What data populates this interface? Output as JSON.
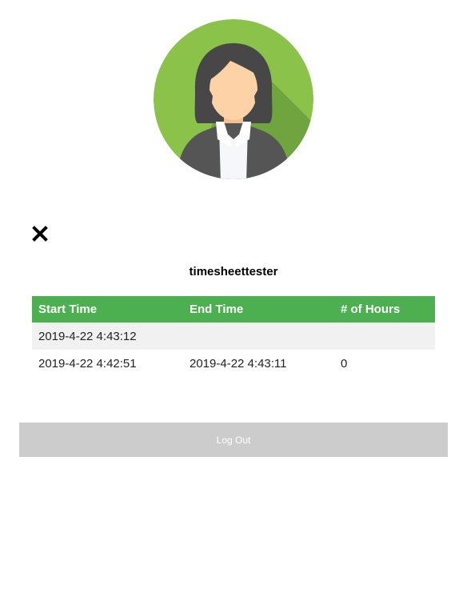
{
  "avatar": {
    "icon": "user-avatar-icon"
  },
  "close": {
    "icon": "close-icon"
  },
  "user": {
    "username": "timesheettester"
  },
  "table": {
    "headers": [
      "Start Time",
      "End Time",
      "# of Hours"
    ],
    "rows": [
      [
        "2019-4-22 4:43:12",
        "",
        ""
      ],
      [
        "2019-4-22 4:42:51",
        "2019-4-22 4:43:11",
        "0"
      ]
    ]
  },
  "logout": {
    "label": "Log Out"
  },
  "colors": {
    "accent": "#4caf50",
    "avatar_bg": "#8bc34a",
    "button_bg": "#cccccc",
    "row_alt": "#f1f1f1"
  }
}
